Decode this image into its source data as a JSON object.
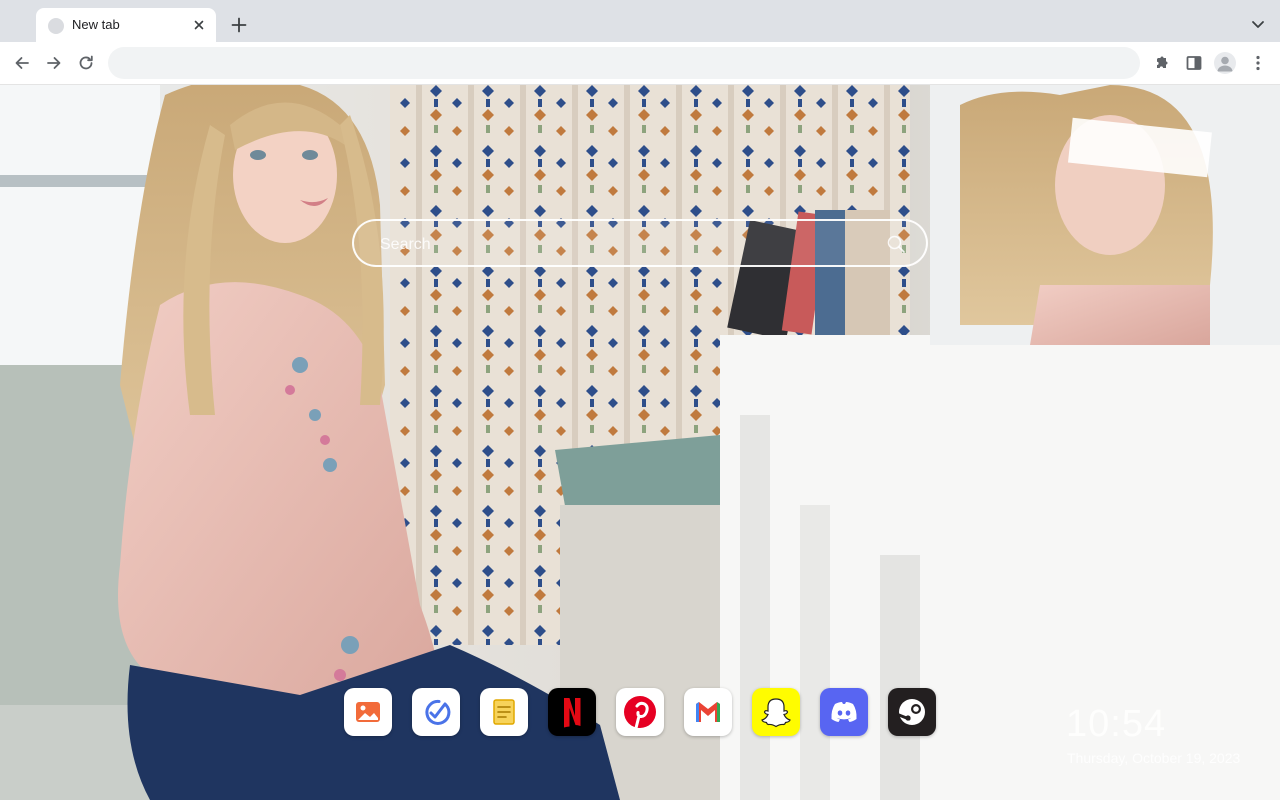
{
  "tabs": [
    {
      "title": "New tab",
      "active": true
    }
  ],
  "omnibox": {
    "value": "",
    "placeholder": ""
  },
  "search": {
    "placeholder": "Search"
  },
  "shortcuts": [
    {
      "name": "Wallpapers",
      "icon": "image-icon",
      "bg": "#ffffff",
      "accent": "#f26b3a"
    },
    {
      "name": "Checklist",
      "icon": "check-icon",
      "bg": "#ffffff",
      "accent": "#4a73e8"
    },
    {
      "name": "Notes",
      "icon": "note-icon",
      "bg": "#ffffff",
      "accent": "#f3b300"
    },
    {
      "name": "Netflix",
      "icon": "netflix-icon",
      "bg": "#000000",
      "accent": "#e50914"
    },
    {
      "name": "Pinterest",
      "icon": "pinterest-icon",
      "bg": "#ffffff",
      "accent": "#e60023"
    },
    {
      "name": "Gmail",
      "icon": "gmail-icon",
      "bg": "#ffffff",
      "accent": "#ea4335"
    },
    {
      "name": "Snapchat",
      "icon": "snapchat-icon",
      "bg": "#fffc00",
      "accent": "#ffffff"
    },
    {
      "name": "Discord",
      "icon": "discord-icon",
      "bg": "#5865f2",
      "accent": "#ffffff"
    },
    {
      "name": "Steam",
      "icon": "steam-icon",
      "bg": "#231f20",
      "accent": "#ffffff"
    }
  ],
  "clock": {
    "time": "10:54",
    "date": "Thursday, October 19, 2023"
  },
  "colors": {
    "tabstrip_bg": "#dee1e6",
    "omnibox_bg": "#f1f3f4",
    "icon_gray": "#5f6368"
  }
}
